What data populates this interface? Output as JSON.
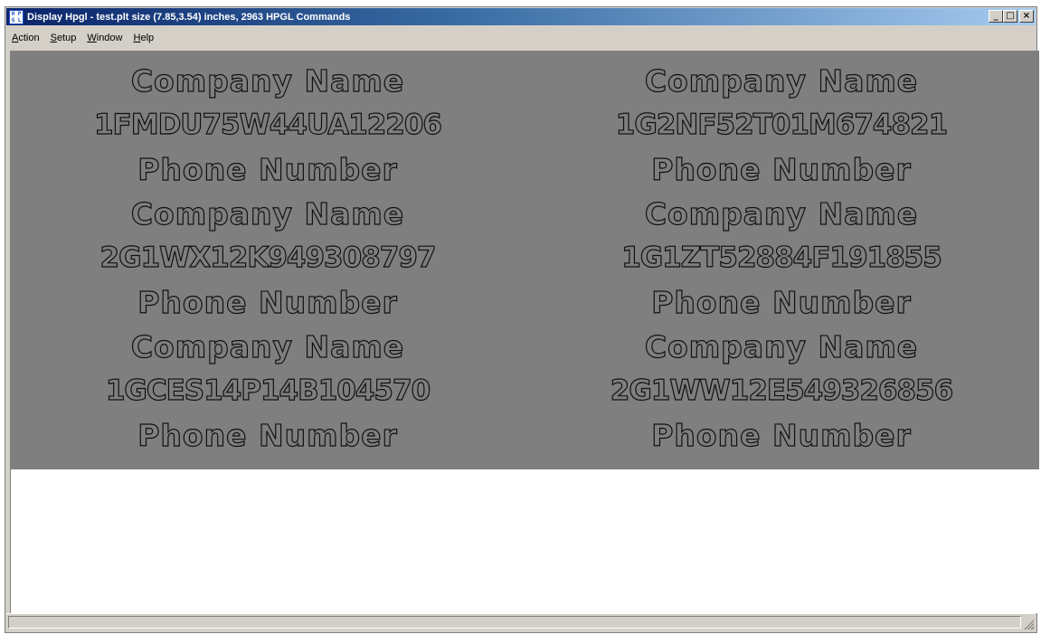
{
  "window": {
    "title": "Display Hpgl - test.plt size (7.85,3.54) inches, 2963 HPGL Commands",
    "icon_glyphs": [
      "H",
      "P",
      "G",
      "L"
    ],
    "caption_buttons": {
      "minimize": "_",
      "maximize": "□",
      "close": "×"
    }
  },
  "menu": {
    "items": [
      {
        "underline": "A",
        "rest": "ction"
      },
      {
        "underline": "S",
        "rest": "etup"
      },
      {
        "underline": "W",
        "rest": "indow"
      },
      {
        "underline": "H",
        "rest": "elp"
      }
    ]
  },
  "plot": {
    "background": "#7f7f7f",
    "left_column": [
      "Company Name",
      "1FMDU75W44UA12206",
      "Phone Number",
      "Company Name",
      "2G1WX12K949308797",
      "Phone Number",
      "Company Name",
      "1GCES14P14B104570",
      "Phone Number"
    ],
    "right_column": [
      "Company Name",
      "1G2NF52T01M674821",
      "Phone Number",
      "Company Name",
      "1G1ZT52884F191855",
      "Phone Number",
      "Company Name",
      "2G1WW12E549326856",
      "Phone Number"
    ]
  },
  "statusbar": {
    "text": ""
  }
}
